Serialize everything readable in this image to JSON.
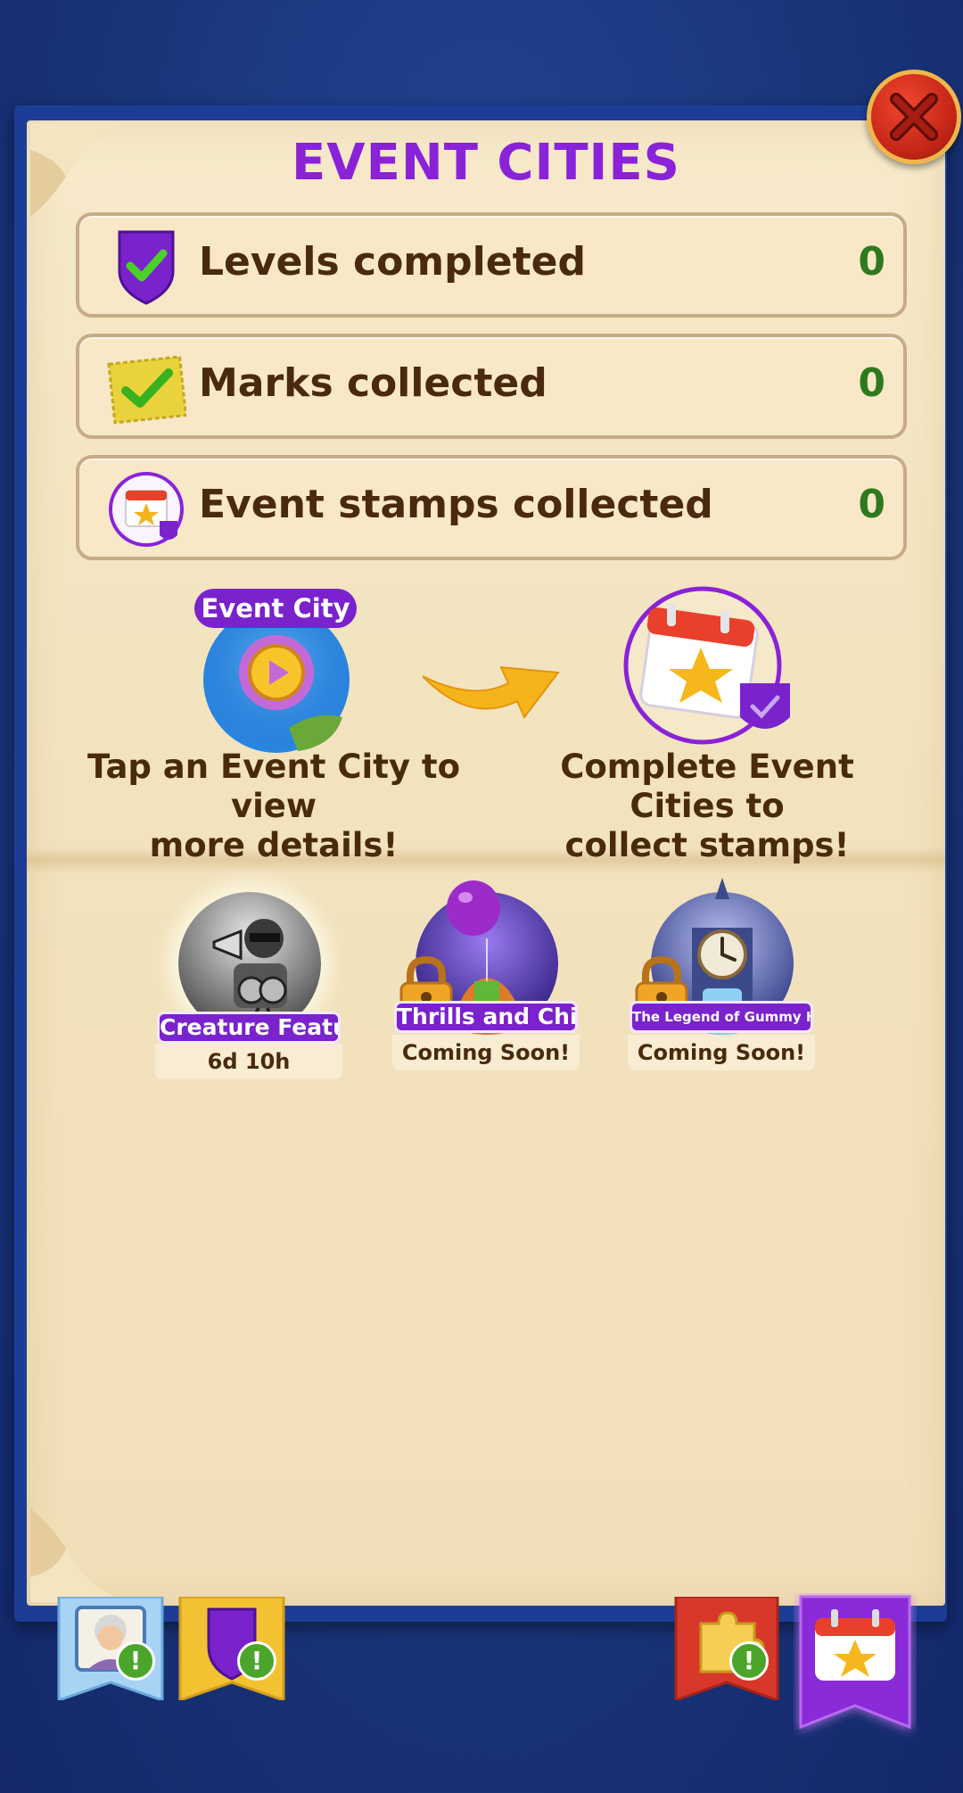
{
  "header": {
    "title": "EVENT CITIES",
    "close_icon": "close-x-icon"
  },
  "stats": [
    {
      "label": "Levels completed",
      "value": "0",
      "icon": "purple-shield-check-icon"
    },
    {
      "label": "Marks collected",
      "value": "0",
      "icon": "yellow-stamp-check-icon"
    },
    {
      "label": "Event stamps collected",
      "value": "0",
      "icon": "calendar-star-stamp-icon"
    }
  ],
  "info": {
    "event_city_pill": "Event City",
    "left_text_1": "Tap an Event City to view",
    "left_text_2": "more details!",
    "right_text_1": "Complete Event Cities to",
    "right_text_2": "collect stamps!"
  },
  "cities": [
    {
      "name": "Creature Feature",
      "status": "6d 10h",
      "locked": false
    },
    {
      "name": "Thrills and Chills",
      "status": "Coming Soon!",
      "locked": true
    },
    {
      "name": "The Legend of Gummy Hollow",
      "status": "Coming Soon!",
      "locked": true
    }
  ],
  "bottom_tabs": [
    {
      "name": "profile",
      "icon": "grandma-portrait-icon",
      "alert": "!"
    },
    {
      "name": "shield",
      "icon": "purple-shield-icon",
      "alert": "!"
    },
    {
      "name": "puzzle",
      "icon": "puzzle-piece-icon",
      "alert": "!"
    },
    {
      "name": "event-cities",
      "icon": "calendar-star-icon",
      "alert": ""
    }
  ],
  "colors": {
    "title": "#8a22d8",
    "stat_value": "#2f7a1e",
    "text_brown": "#4a2a0c",
    "purple_tag": "#7a22cc",
    "background_blue": "#1a357a"
  }
}
